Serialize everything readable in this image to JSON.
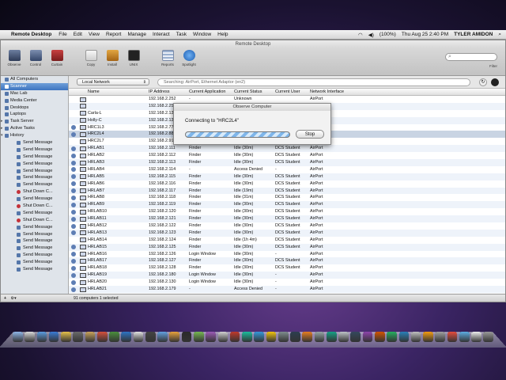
{
  "menubar": {
    "app": "Remote Desktop",
    "items": [
      "File",
      "Edit",
      "View",
      "Report",
      "Manage",
      "Interact",
      "Task",
      "Window",
      "Help"
    ],
    "battery": "(100%)",
    "clock": "Thu Aug 25  2:40 PM",
    "user": "TYLER AMIDON"
  },
  "window": {
    "title": "Remote Desktop"
  },
  "toolbar": {
    "observe": "Observe",
    "control": "Control",
    "curtain": "Curtain",
    "copy": "Copy",
    "install": "Install",
    "unix": "UNIX",
    "reports": "Reports",
    "spotlight": "Spotlight",
    "filter": "Filter"
  },
  "sidebar": {
    "items": [
      {
        "label": "All Computers"
      },
      {
        "label": "Scanner"
      },
      {
        "label": "Mac Lab"
      },
      {
        "label": "Media Center"
      },
      {
        "label": "Desktops"
      },
      {
        "label": "Laptops"
      },
      {
        "label": "Task Server"
      },
      {
        "label": "Active Tasks"
      },
      {
        "label": "History"
      },
      {
        "label": "Send Message"
      },
      {
        "label": "Send Message"
      },
      {
        "label": "Send Message"
      },
      {
        "label": "Send Message"
      },
      {
        "label": "Send Message"
      },
      {
        "label": "Send Message"
      },
      {
        "label": "Send Message"
      },
      {
        "label": "Shut Down C..."
      },
      {
        "label": "Send Message"
      },
      {
        "label": "Shut Down C..."
      },
      {
        "label": "Send Message"
      },
      {
        "label": "Shut Down C..."
      },
      {
        "label": "Send Message"
      },
      {
        "label": "Send Message"
      },
      {
        "label": "Send Message"
      },
      {
        "label": "Send Message"
      },
      {
        "label": "Send Message"
      },
      {
        "label": "Send Message"
      },
      {
        "label": "Send Message"
      }
    ]
  },
  "scope": {
    "network": "Local Network",
    "status": "Searching: AirPort, Ethernet Adaptor (en2)"
  },
  "table": {
    "headers": [
      "Name",
      "IP Address",
      "Current Application",
      "Current Status",
      "Current User",
      "Network Interface"
    ],
    "rows": [
      [
        "",
        "192.168.2.252",
        "-",
        "Unknown",
        "",
        "AirPort"
      ],
      [
        "",
        "192.168.2.25",
        "",
        "",
        "",
        ""
      ],
      [
        "Carla-L",
        "192.168.2.13",
        "",
        "",
        "",
        ""
      ],
      [
        "Holly-C",
        "192.168.2.13",
        "",
        "",
        "",
        ""
      ],
      [
        "HRC1L3",
        "192.168.2.77",
        "",
        "",
        "",
        ""
      ],
      [
        "HRC2L4",
        "192.168.2.88",
        "",
        "",
        "",
        ""
      ],
      [
        "HRC2L7",
        "192.168.2.91",
        "",
        "",
        "",
        ""
      ],
      [
        "HRLAB1",
        "192.168.2.111",
        "Finder",
        "Idle (30m)",
        "DCS Student",
        "AirPort"
      ],
      [
        "HRLAB2",
        "192.168.2.112",
        "Finder",
        "Idle (30m)",
        "DCS Student",
        "AirPort"
      ],
      [
        "HRLAB3",
        "192.168.2.113",
        "Finder",
        "Idle (30m)",
        "DCS Student",
        "AirPort"
      ],
      [
        "HRLAB4",
        "192.168.2.114",
        "-",
        "Access Denied",
        "-",
        "AirPort"
      ],
      [
        "HRLAB5",
        "192.168.2.115",
        "Finder",
        "Idle (30m)",
        "DCS Student",
        "AirPort"
      ],
      [
        "HRLAB6",
        "192.168.2.116",
        "Finder",
        "Idle (30m)",
        "DCS Student",
        "AirPort"
      ],
      [
        "HRLAB7",
        "192.168.2.117",
        "Finder",
        "Idle (19m)",
        "DCS Student",
        "AirPort"
      ],
      [
        "HRLAB8",
        "192.168.2.118",
        "Finder",
        "Idle (31m)",
        "DCS Student",
        "AirPort"
      ],
      [
        "HRLAB9",
        "192.168.2.119",
        "Finder",
        "Idle (30m)",
        "DCS Student",
        "AirPort"
      ],
      [
        "HRLAB10",
        "192.168.2.120",
        "Finder",
        "Idle (30m)",
        "DCS Student",
        "AirPort"
      ],
      [
        "HRLAB11",
        "192.168.2.121",
        "Finder",
        "Idle (30m)",
        "DCS Student",
        "AirPort"
      ],
      [
        "HRLAB12",
        "192.168.2.122",
        "Finder",
        "Idle (30m)",
        "DCS Student",
        "AirPort"
      ],
      [
        "HRLAB13",
        "192.168.2.123",
        "Finder",
        "Idle (30m)",
        "DCS Student",
        "AirPort"
      ],
      [
        "HRLAB14",
        "192.168.2.124",
        "Finder",
        "Idle (1h 4m)",
        "DCS Student",
        "AirPort"
      ],
      [
        "HRLAB15",
        "192.168.2.125",
        "Finder",
        "Idle (30m)",
        "DCS Student",
        "AirPort"
      ],
      [
        "HRLAB16",
        "192.168.2.126",
        "Login Window",
        "Idle (30m)",
        "-",
        "AirPort"
      ],
      [
        "HRLAB17",
        "192.168.2.127",
        "Finder",
        "Idle (30m)",
        "DCS Student",
        "AirPort"
      ],
      [
        "HRLAB18",
        "192.168.2.128",
        "Finder",
        "Idle (30m)",
        "DCS Student",
        "AirPort"
      ],
      [
        "HRLAB19",
        "192.168.2.180",
        "Login Window",
        "Idle (30m)",
        "-",
        "AirPort"
      ],
      [
        "HRLAB20",
        "192.168.2.130",
        "Login Window",
        "Idle (30m)",
        "-",
        "AirPort"
      ],
      [
        "HRLAB21",
        "192.168.2.179",
        "-",
        "Access Denied",
        "-",
        "AirPort"
      ],
      [
        "HRLAB22",
        "192.168.2.132",
        "Login Window",
        "Idle (29m)",
        "-",
        "AirPort"
      ]
    ]
  },
  "status_bar": {
    "summary": "91 computers    1 selected"
  },
  "sheet": {
    "title": "Observe Computer",
    "message": "Connecting to \"HRC2L4\"",
    "stop": "Stop"
  },
  "colors": {
    "selection": "#3e75c0",
    "progress": "#7fb6ea"
  }
}
